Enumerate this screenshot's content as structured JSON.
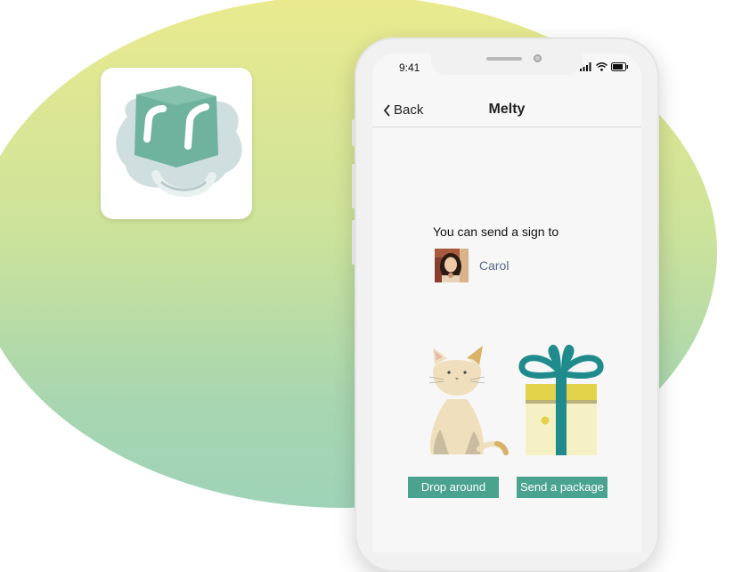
{
  "app_icon": {
    "icon": "ice-cube-icon"
  },
  "status_bar": {
    "time": "9:41",
    "icons": [
      "signal-icon",
      "wifi-icon",
      "battery-icon"
    ]
  },
  "nav": {
    "back_label": "Back",
    "title": "Melty"
  },
  "content": {
    "send_text": "You can send a sign to",
    "recipient_name": "Carol"
  },
  "actions": {
    "drop_around": "Drop around",
    "send_package": "Send a package"
  },
  "colors": {
    "accent": "#4aa38f",
    "icon_green": "#6fb39e",
    "gift_teal": "#1f8b8c",
    "gift_yellow": "#e2d34a"
  }
}
